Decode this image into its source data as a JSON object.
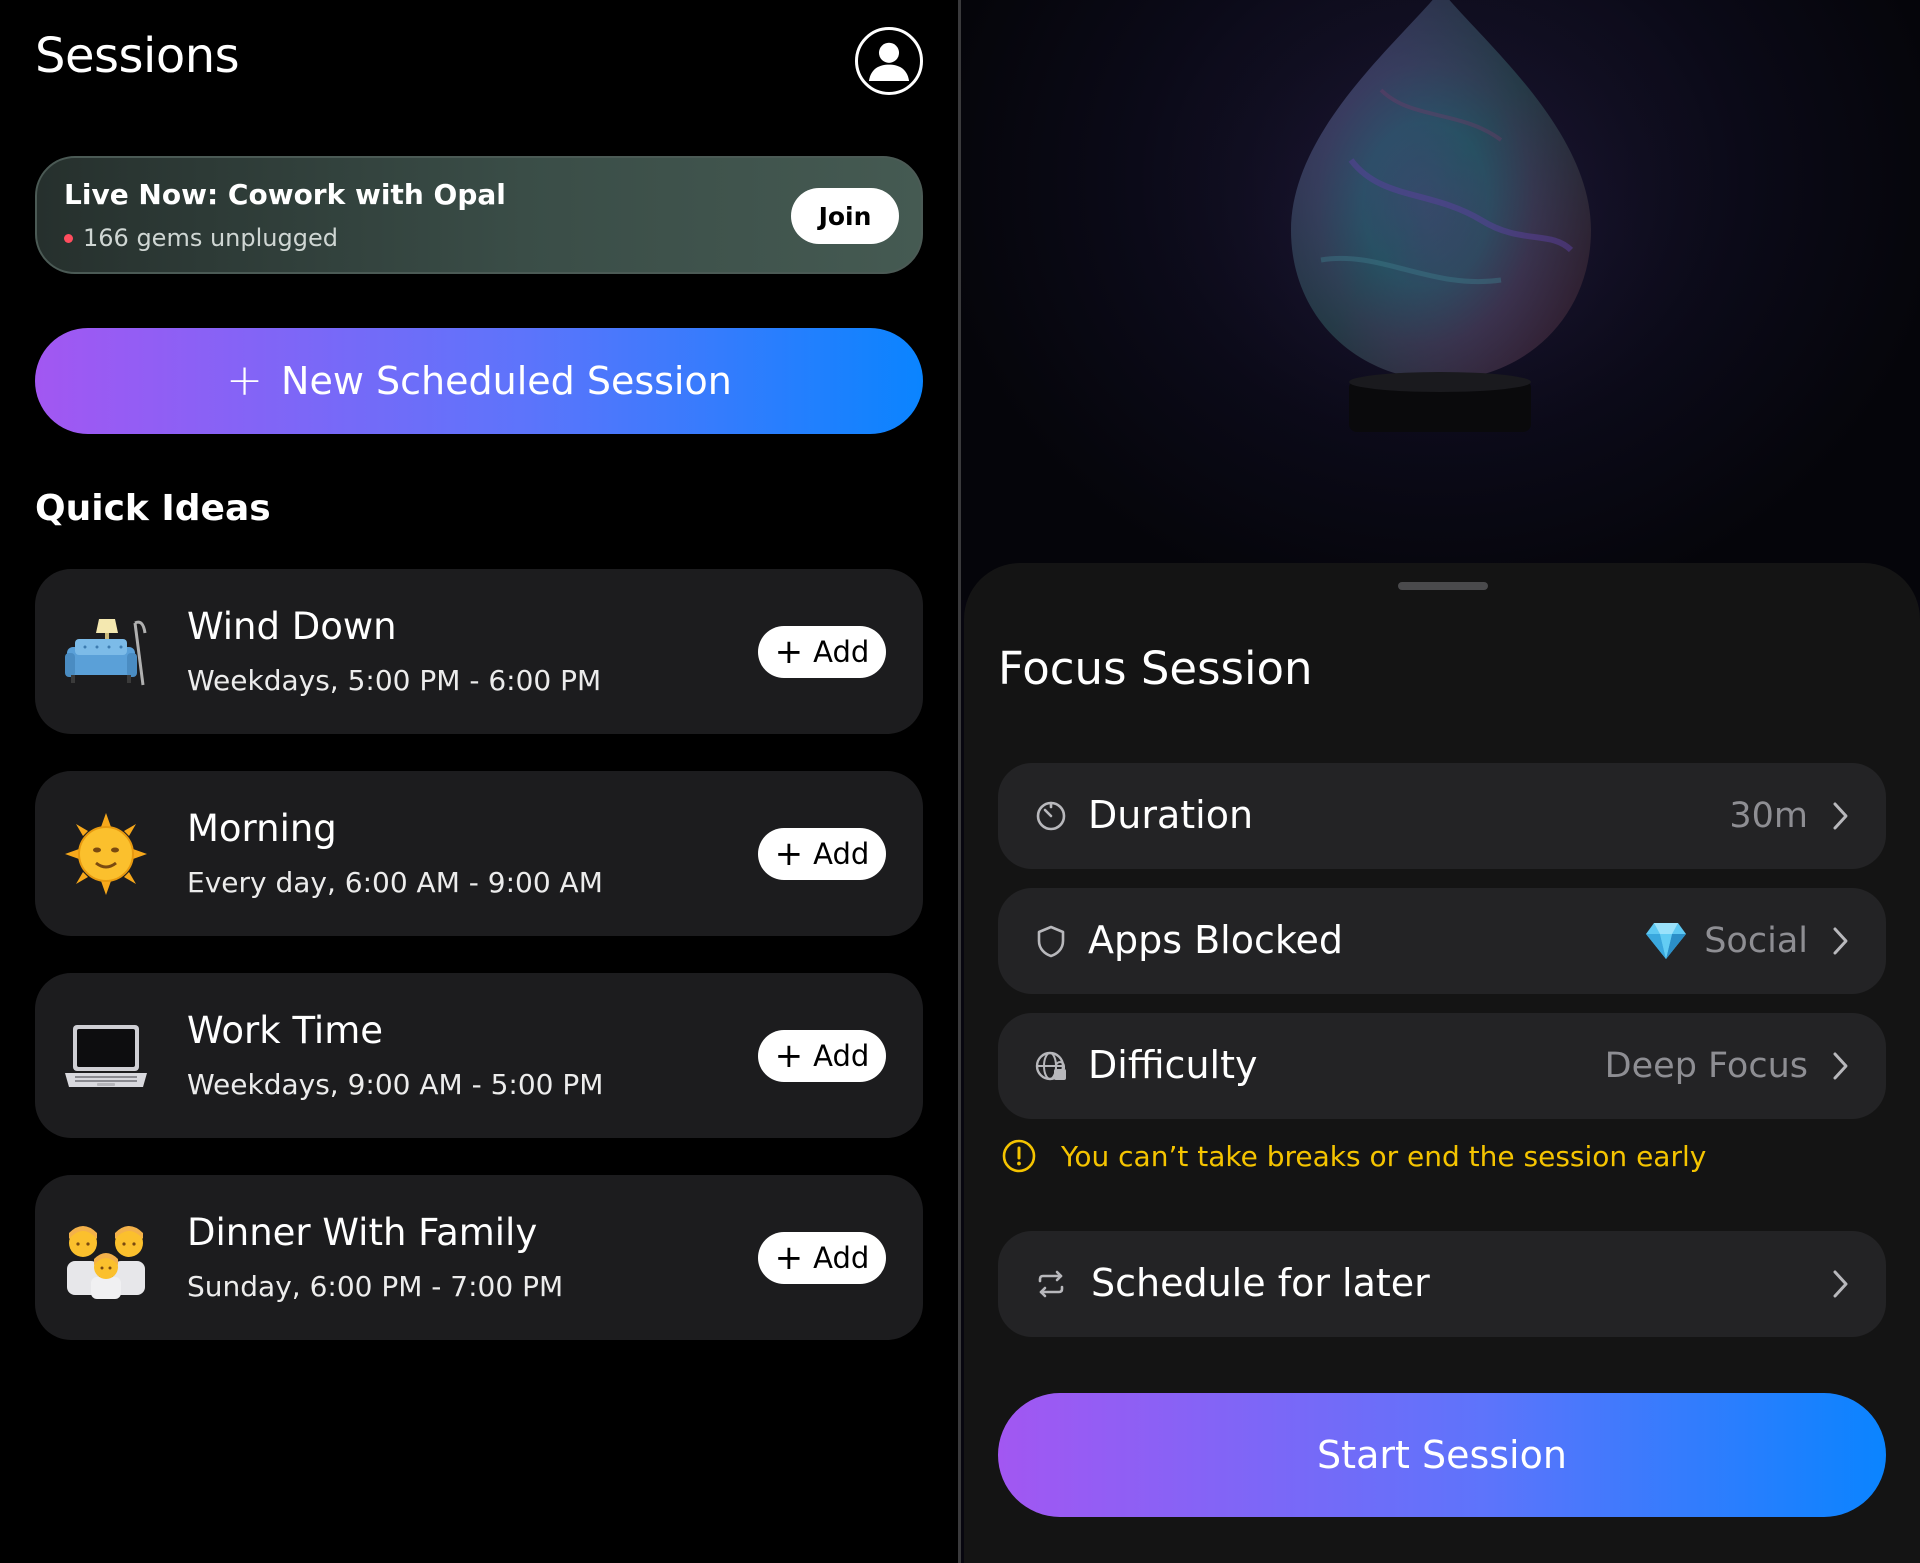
{
  "sessions": {
    "title": "Sessions",
    "live": {
      "title": "Live Now: Cowork with Opal",
      "subtitle": "166 gems unplugged",
      "join_label": "Join"
    },
    "new_session_label": "New Scheduled Session",
    "quick_ideas_title": "Quick Ideas",
    "add_label": "Add",
    "ideas": [
      {
        "name": "Wind Down",
        "when": "Weekdays, 5:00 PM - 6:00 PM",
        "icon": "couch-lamp-icon"
      },
      {
        "name": "Morning",
        "when": "Every day, 6:00 AM - 9:00 AM",
        "icon": "sun-face-icon"
      },
      {
        "name": "Work Time",
        "when": "Weekdays, 9:00 AM - 5:00 PM",
        "icon": "laptop-icon"
      },
      {
        "name": "Dinner With Family",
        "when": "Sunday, 6:00 PM - 7:00 PM",
        "icon": "family-icon"
      }
    ]
  },
  "focus": {
    "title": "Focus Session",
    "rows": [
      {
        "label": "Duration",
        "value": "30m",
        "icon": "timer-icon"
      },
      {
        "label": "Apps Blocked",
        "value": "Social",
        "icon": "shield-icon",
        "value_icon": "gem-icon"
      },
      {
        "label": "Difficulty",
        "value": "Deep Focus",
        "icon": "globe-lock-icon"
      }
    ],
    "warning": "You can’t take breaks or end the session early",
    "schedule_label": "Schedule for later",
    "start_label": "Start Session"
  },
  "colors": {
    "accent_gradient_start": "#a257f2",
    "accent_gradient_end": "#0a84ff",
    "warning": "#f5c400",
    "live_dot": "#ff4d5e"
  }
}
